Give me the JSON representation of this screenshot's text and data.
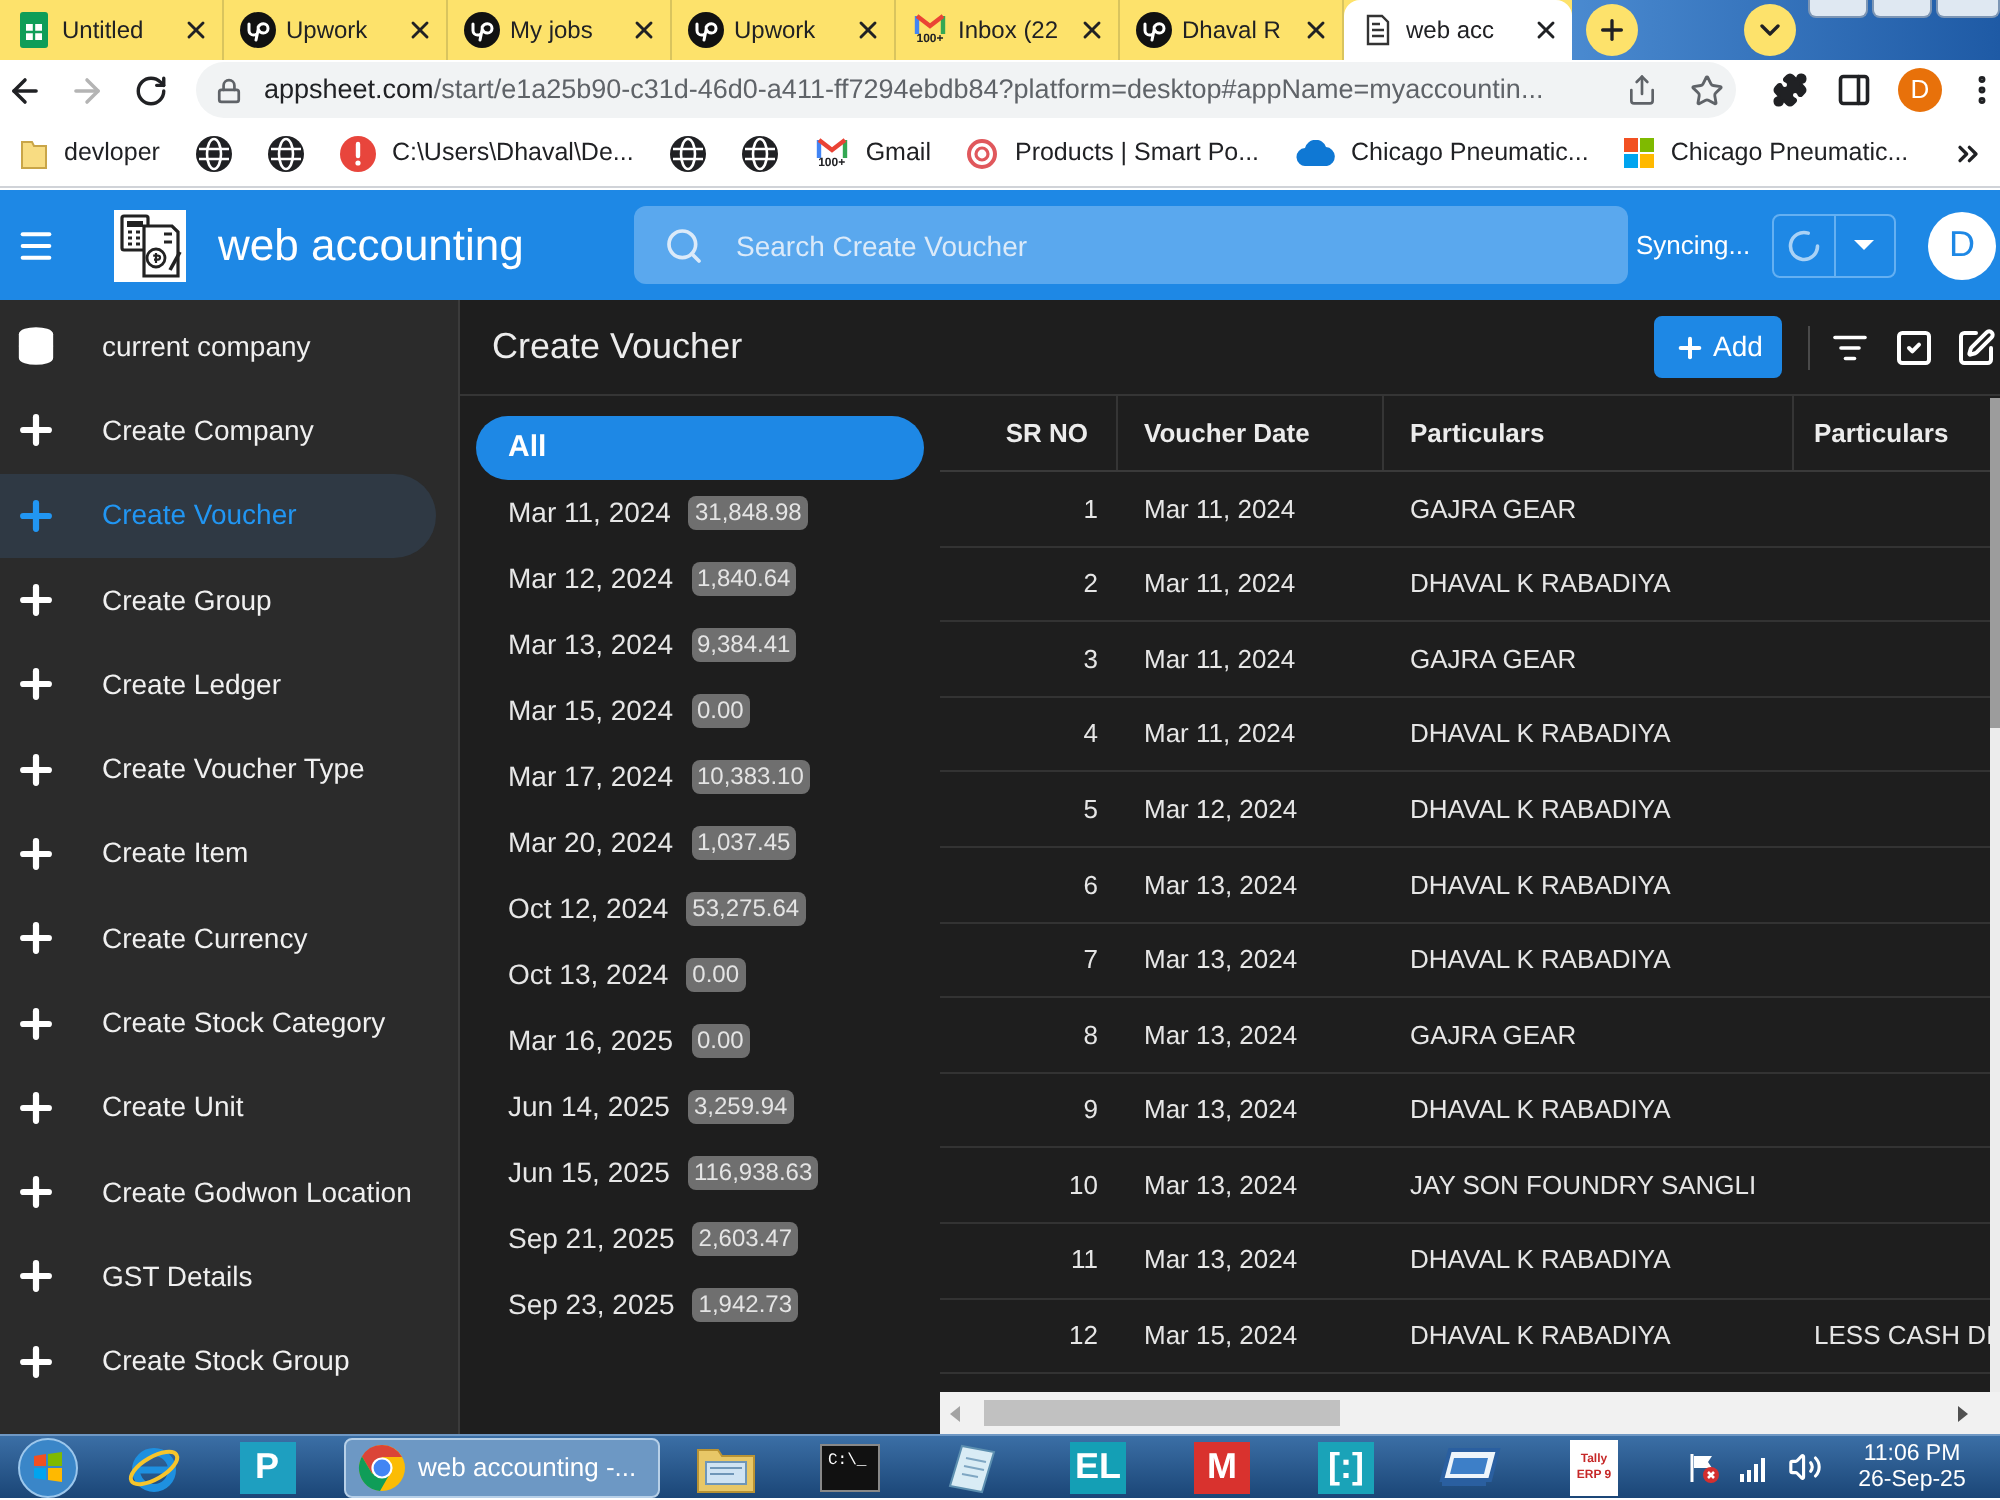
{
  "browser": {
    "tabs": [
      {
        "kind": "sheet",
        "title": "Untitled",
        "selected": false
      },
      {
        "kind": "circle-logo",
        "title": "Upwork",
        "selected": false
      },
      {
        "kind": "circle-logo",
        "title": "My jobs",
        "selected": false
      },
      {
        "kind": "circle-logo",
        "title": "Upwork",
        "selected": false
      },
      {
        "kind": "mail",
        "title": "Inbox (22",
        "badge": "100+",
        "selected": false
      },
      {
        "kind": "circle-logo",
        "title": "Dhaval R",
        "selected": false
      },
      {
        "kind": "page",
        "title": "web acc",
        "selected": true
      }
    ],
    "forward_disabled": true,
    "address": {
      "domain": "appsheet.com",
      "path": "/start/e1a25b90-c31d-46d0-a411-ff7294ebdb84?platform=desktop#appName=myaccountin..."
    },
    "profile_initial": "D",
    "bookmarks": [
      {
        "kind": "folder",
        "label": "devloper"
      },
      {
        "kind": "globe"
      },
      {
        "kind": "globe"
      },
      {
        "kind": "alert",
        "label": "C:\\Users\\Dhaval\\De..."
      },
      {
        "kind": "globe"
      },
      {
        "kind": "globe"
      },
      {
        "kind": "mail",
        "label": "Gmail",
        "badge": "100+"
      },
      {
        "kind": "ring",
        "label": "Products | Smart Po..."
      },
      {
        "kind": "cloud",
        "label": "Chicago Pneumatic..."
      },
      {
        "kind": "windows",
        "label": "Chicago Pneumatic..."
      }
    ]
  },
  "app": {
    "title": "web accounting",
    "search": {
      "placeholder": "Search Create Voucher"
    },
    "sync_status": "Syncing...",
    "avatar_initial": "D"
  },
  "sidebar": {
    "items": [
      {
        "kind": "database",
        "label": "current company",
        "selected": false
      },
      {
        "kind": "plus",
        "label": "Create Company",
        "selected": false
      },
      {
        "kind": "plus",
        "label": "Create Voucher",
        "selected": true
      },
      {
        "kind": "plus",
        "label": "Create Group",
        "selected": false
      },
      {
        "kind": "plus",
        "label": "Create Ledger",
        "selected": false
      },
      {
        "kind": "plus",
        "label": "Create Voucher Type",
        "selected": false
      },
      {
        "kind": "plus",
        "label": "Create Item",
        "selected": false
      },
      {
        "kind": "plus",
        "label": "Create Currency",
        "selected": false
      },
      {
        "kind": "plus",
        "label": "Create Stock Category",
        "selected": false
      },
      {
        "kind": "plus",
        "label": "Create Unit",
        "selected": false
      },
      {
        "kind": "plus",
        "label": "Create Godwon Location",
        "selected": false
      },
      {
        "kind": "plus",
        "label": "GST Details",
        "selected": false
      },
      {
        "kind": "plus",
        "label": "Create Stock Group",
        "selected": false
      }
    ]
  },
  "view": {
    "title": "Create Voucher",
    "add_button": "Add",
    "date_groups": [
      {
        "label": "All",
        "selected": true
      },
      {
        "label": "Mar 11, 2024",
        "total": "31,848.98",
        "selected": false
      },
      {
        "label": "Mar 12, 2024",
        "total": "1,840.64",
        "selected": false
      },
      {
        "label": "Mar 13, 2024",
        "total": "9,384.41",
        "selected": false
      },
      {
        "label": "Mar 15, 2024",
        "total": "0.00",
        "selected": false
      },
      {
        "label": "Mar 17, 2024",
        "total": "10,383.10",
        "selected": false
      },
      {
        "label": "Mar 20, 2024",
        "total": "1,037.45",
        "selected": false
      },
      {
        "label": "Oct 12, 2024",
        "total": "53,275.64",
        "selected": false
      },
      {
        "label": "Oct 13, 2024",
        "total": "0.00",
        "selected": false
      },
      {
        "label": "Mar 16, 2025",
        "total": "0.00",
        "selected": false
      },
      {
        "label": "Jun 14, 2025",
        "total": "3,259.94",
        "selected": false
      },
      {
        "label": "Jun 15, 2025",
        "total": "116,938.63",
        "selected": false
      },
      {
        "label": "Sep 21, 2025",
        "total": "2,603.47",
        "selected": false
      },
      {
        "label": "Sep 23, 2025",
        "total": "1,942.73",
        "selected": false
      }
    ]
  },
  "table": {
    "columns": [
      "SR NO",
      "Voucher Date",
      "Particulars",
      "Particulars"
    ],
    "rows": [
      {
        "sr_no": "1",
        "voucher_date": "Mar 11, 2024",
        "particulars": "GAJRA GEAR"
      },
      {
        "sr_no": "2",
        "voucher_date": "Mar 11, 2024",
        "particulars": "DHAVAL K RABADIYA"
      },
      {
        "sr_no": "3",
        "voucher_date": "Mar 11, 2024",
        "particulars": "GAJRA GEAR"
      },
      {
        "sr_no": "4",
        "voucher_date": "Mar 11, 2024",
        "particulars": "DHAVAL K RABADIYA"
      },
      {
        "sr_no": "5",
        "voucher_date": "Mar 12, 2024",
        "particulars": "DHAVAL K RABADIYA"
      },
      {
        "sr_no": "6",
        "voucher_date": "Mar 13, 2024",
        "particulars": "DHAVAL K RABADIYA"
      },
      {
        "sr_no": "7",
        "voucher_date": "Mar 13, 2024",
        "particulars": "DHAVAL K RABADIYA"
      },
      {
        "sr_no": "8",
        "voucher_date": "Mar 13, 2024",
        "particulars": "GAJRA GEAR"
      },
      {
        "sr_no": "9",
        "voucher_date": "Mar 13, 2024",
        "particulars": "DHAVAL K RABADIYA"
      },
      {
        "sr_no": "10",
        "voucher_date": "Mar 13, 2024",
        "particulars": "JAY SON FOUNDRY SANGLI"
      },
      {
        "sr_no": "11",
        "voucher_date": "Mar 13, 2024",
        "particulars": "DHAVAL K RABADIYA"
      },
      {
        "sr_no": "12",
        "voucher_date": "Mar 15, 2024",
        "particulars": "DHAVAL K RABADIYA",
        "particulars_2": "LESS CASH DI"
      }
    ]
  },
  "taskbar": {
    "apps": [
      {
        "kind": "start",
        "selected": false
      },
      {
        "kind": "ie",
        "selected": false
      },
      {
        "kind": "tile",
        "label": "P",
        "color": "#1e9fc0",
        "selected": false
      },
      {
        "kind": "chrome",
        "label": "web accounting -...",
        "selected": true
      },
      {
        "kind": "folder",
        "selected": false
      },
      {
        "kind": "terminal",
        "label": "C:\\_",
        "selected": false
      },
      {
        "kind": "document",
        "selected": false
      },
      {
        "kind": "tile",
        "label": "EL",
        "color": "#149fb5",
        "selected": false
      },
      {
        "kind": "tile",
        "label": "M",
        "color": "#d9322e",
        "selected": false
      },
      {
        "kind": "tile",
        "label": "[:]",
        "color": "#1aa3b8",
        "selected": false
      },
      {
        "kind": "screen",
        "selected": false
      },
      {
        "kind": "tally",
        "label": "Tally",
        "sublabel": "ERP 9",
        "selected": false
      }
    ],
    "clock": {
      "time": "11:06 PM",
      "date": "26-Sep-25"
    }
  }
}
